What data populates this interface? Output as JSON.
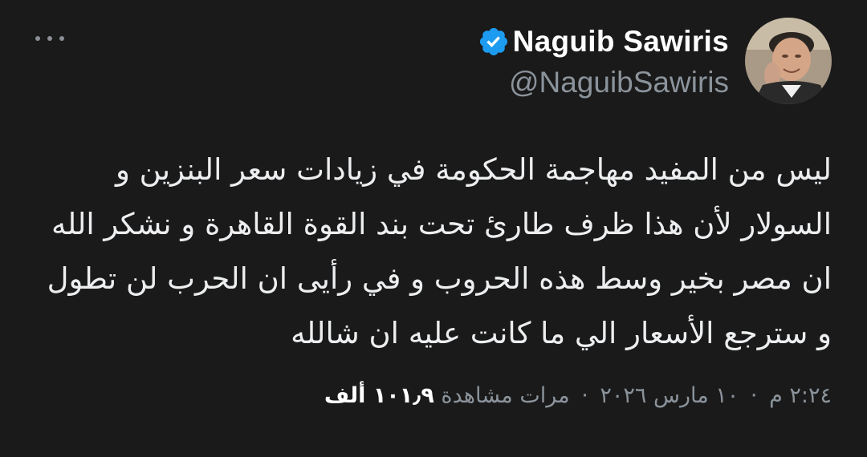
{
  "tweet": {
    "author": {
      "display_name": "Naguib Sawiris",
      "handle": "@NaguibSawiris",
      "verified": true,
      "avatar": "author-photo"
    },
    "body": "ليس من المفيد مهاجمة الحكومة في زيادات سعر البنزين و السولار لأن هذا ظرف طارئ تحت بند القوة القاهرة و نشكر الله ان مصر بخير وسط هذه الحروب و في رأيى ان الحرب لن تطول و سترجع الأسعار الي ما كانت عليه ان شالله",
    "meta": {
      "time": "٢:٢٤ م",
      "date": "١٠ مارس ٢٠٢٦",
      "separator": "·",
      "views_count": "١٠١٫٩ ألف",
      "views_label": "مرات مشاهدة"
    },
    "more_icon": "ellipsis-icon"
  },
  "colors": {
    "background": "#1a1a1a",
    "text": "#e7e9ea",
    "secondary": "#8b939b",
    "verified_blue": "#1d9bf0"
  }
}
